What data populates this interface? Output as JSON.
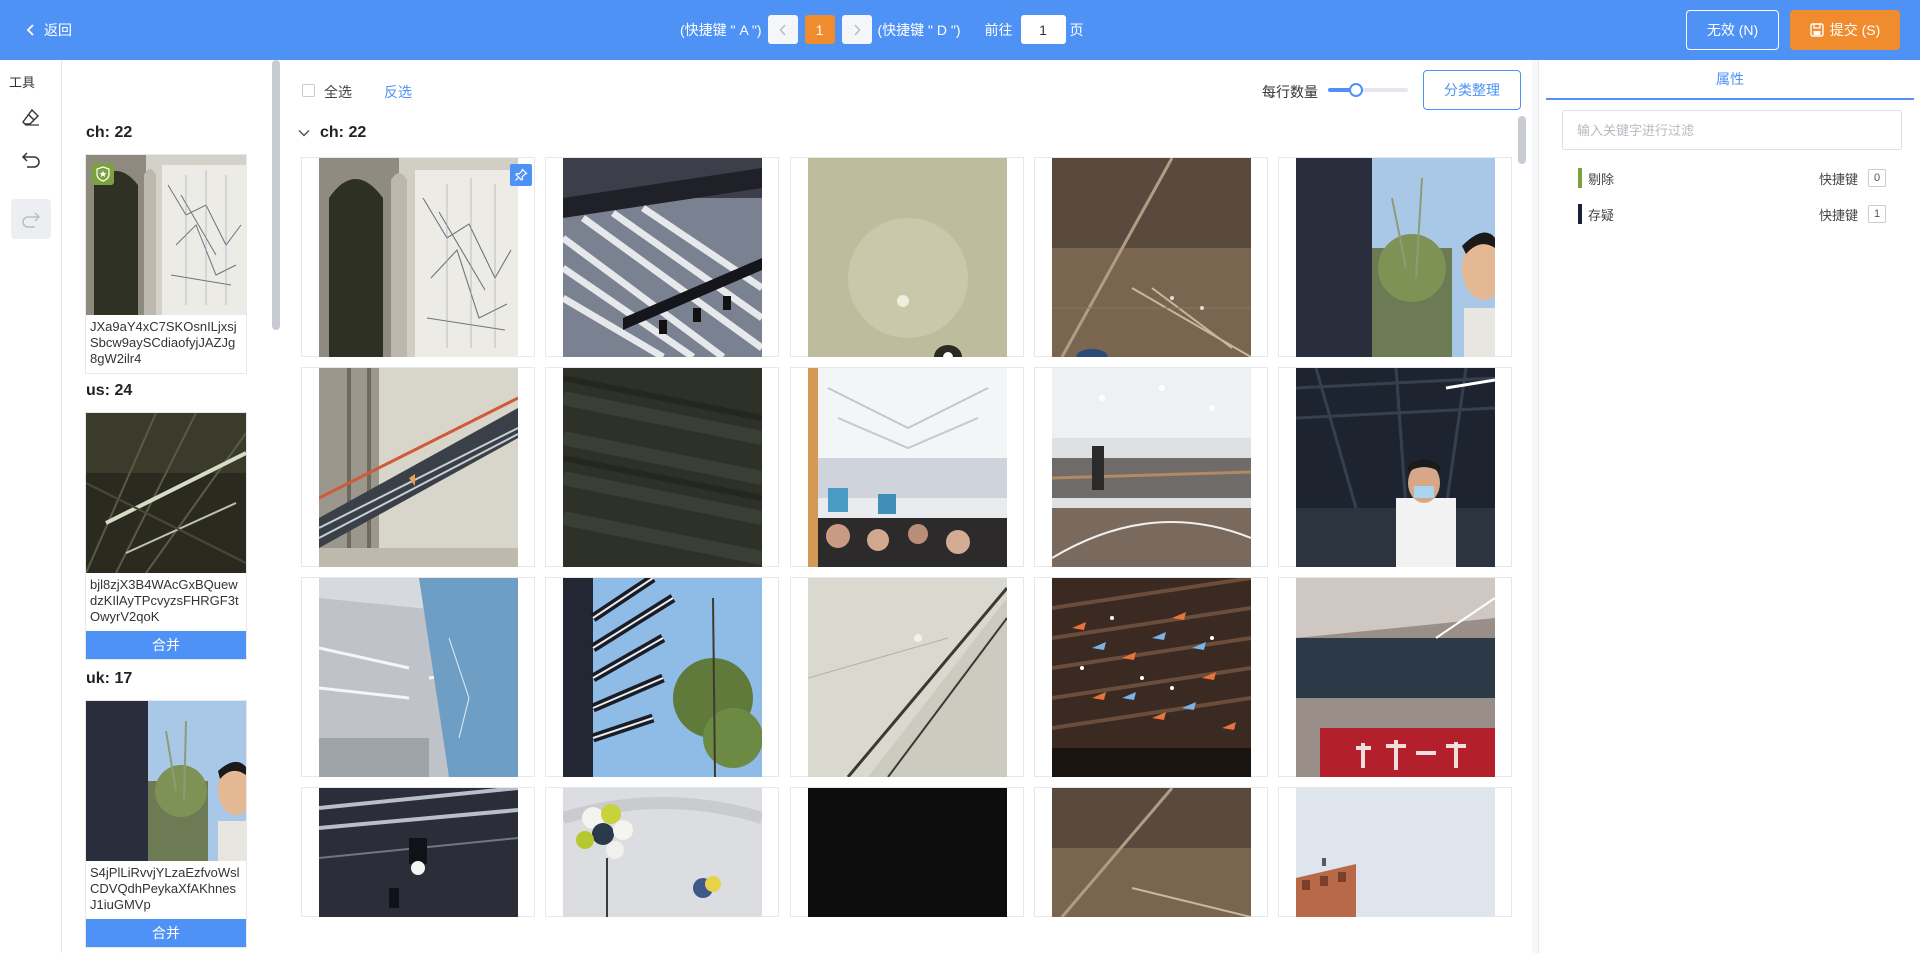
{
  "topbar": {
    "back_label": "返回",
    "prev_hint": "(快捷键 \" A \")",
    "current_page": "1",
    "next_hint": "(快捷键 \" D \")",
    "goto_label": "前往",
    "goto_value": "1",
    "page_unit": "页",
    "invalid_label": "无效 (N)",
    "submit_label": "提交 (S)",
    "background_color": "#4f92f6",
    "accent_color": "#f08b2e"
  },
  "tools": {
    "title": "工具",
    "items": [
      "eraser-icon",
      "undo-icon",
      "redo-icon"
    ]
  },
  "thumbnails": {
    "groups": [
      {
        "label": "ch: 22",
        "id": "JXa9aY4xC7SKOsnILjxsjSbcw9aySCdiaofyjJAZJg8gW2ilr4",
        "badge": "shield-star-icon",
        "merge_label": ""
      },
      {
        "label": "us: 24",
        "id": "bjl8zjX3B4WAcGxBQuewdzKIlAyTPcvyzsFHRGF3tOwyrV2qoK",
        "merge_label": "合并"
      },
      {
        "label": "uk: 17",
        "id": "S4jPlLiRvvjYLzaEzfvoWslCDVQdhPeykaXfAKhnesJ1iuGMVp",
        "merge_label": "合并"
      }
    ]
  },
  "main": {
    "select_all_label": "全选",
    "invert_label": "反选",
    "per_row_label": "每行数量",
    "per_row_slider_fraction": 0.35,
    "classify_label": "分类整理",
    "section_label": "ch: 22",
    "pin_icon": "pin-icon"
  },
  "right": {
    "tab_label": "属性",
    "filter_placeholder": "输入关键字进行过滤",
    "labels": [
      {
        "name": "剔除",
        "hotkey_label": "快捷键",
        "key": "0",
        "color": "#7ba23f"
      },
      {
        "name": "存疑",
        "hotkey_label": "快捷键",
        "key": "1",
        "color": "#1a1f3a"
      }
    ]
  }
}
